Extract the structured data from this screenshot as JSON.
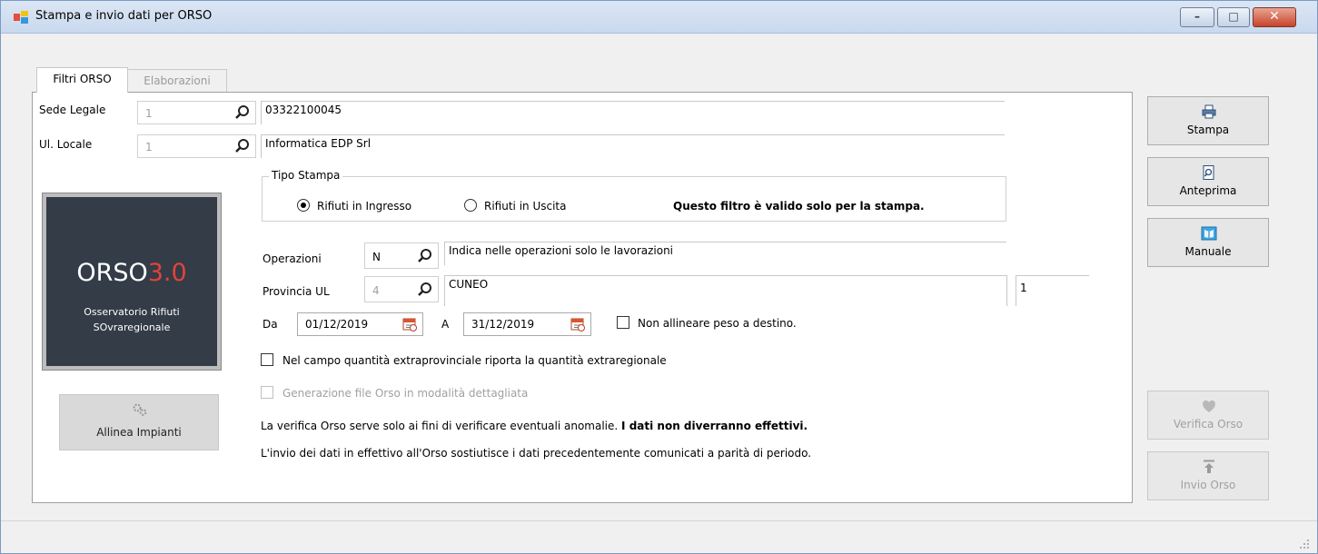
{
  "window": {
    "title": "Stampa e invio dati per ORSO",
    "minimize_glyph": "–",
    "maximize_glyph": "□",
    "close_glyph": "✕"
  },
  "tabs": [
    {
      "label": "Filtri ORSO",
      "active": true
    },
    {
      "label": "Elaborazioni",
      "active": false
    }
  ],
  "sede_legale": {
    "label": "Sede Legale",
    "code": "1",
    "value": "03322100045"
  },
  "ul_locale": {
    "label": "Ul. Locale",
    "code": "1",
    "value": "Informatica EDP Srl"
  },
  "tipo_stampa": {
    "title": "Tipo Stampa",
    "options": [
      {
        "label": "Rifiuti in Ingresso",
        "selected": true
      },
      {
        "label": "Rifiuti in Uscita",
        "selected": false
      }
    ],
    "note": "Questo filtro è valido solo per la stampa."
  },
  "operazioni": {
    "label": "Operazioni",
    "code": "N",
    "value": "Indica nelle operazioni solo le lavorazioni"
  },
  "provincia": {
    "label": "Provincia UL",
    "code": "4",
    "value": "CUNEO",
    "extra": "1"
  },
  "date_range": {
    "from_label": "Da",
    "from_value": "01/12/2019",
    "to_label": "A",
    "to_value": "31/12/2019"
  },
  "checkboxes": {
    "non_allineare": {
      "label": "Non allineare peso a destino.",
      "checked": false
    },
    "extraprovinciale": {
      "label": "Nel campo quantità extraprovinciale riporta la quantità extraregionale",
      "checked": false
    },
    "dettagliata": {
      "label": "Generazione file Orso in modalità dettagliata",
      "checked": false,
      "enabled": false
    }
  },
  "info": {
    "line1_text": "La verifica Orso serve solo ai fini di verificare eventuali anomalie.",
    "line1_bold": "I dati non diverranno effettivi.",
    "line2": "L'invio dei dati in effettivo all'Orso sostiutisce i dati precedentemente comunicati a parità di periodo."
  },
  "logo": {
    "name_main": "ORSO",
    "name_version": "3.0",
    "subtitle_line1": "Osservatorio Rifiuti",
    "subtitle_line2": "SOvraregionale"
  },
  "buttons": {
    "allinea_impianti": "Allinea Impianti",
    "stampa": "Stampa",
    "anteprima": "Anteprima",
    "manuale": "Manuale",
    "verifica_orso": "Verifica Orso",
    "invio_orso": "Invio Orso"
  },
  "colors": {
    "logo_bg": "#333c47",
    "logo_accent": "#e3423b",
    "window_bg": "#f0f0f0",
    "disabled_text": "#a0a0a0"
  },
  "icons": [
    "app-icon",
    "search-icon",
    "calendar-icon",
    "printer-icon",
    "preview-icon",
    "book-icon",
    "gears-icon",
    "heart-icon",
    "upload-icon"
  ]
}
